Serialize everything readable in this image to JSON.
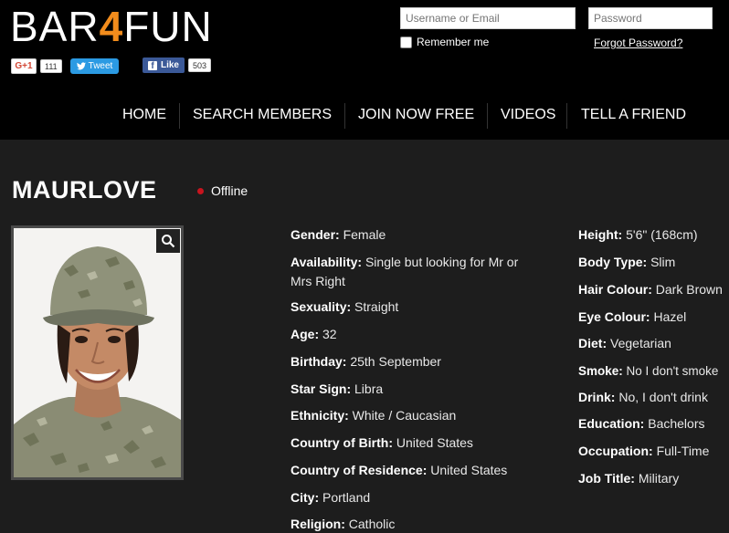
{
  "logo": {
    "part1": "BAR",
    "part2": "4",
    "part3": "FUN"
  },
  "social": {
    "gplus_label": "G+1",
    "gplus_count": "111",
    "tweet_label": "Tweet",
    "like_label": "Like",
    "like_count": "503"
  },
  "login": {
    "username_placeholder": "Username or Email",
    "password_placeholder": "Password",
    "remember_label": "Remember me",
    "forgot_label": "Forgot Password?"
  },
  "nav": {
    "items": [
      "HOME",
      "SEARCH MEMBERS",
      "JOIN NOW FREE",
      "VIDEOS",
      "TELL A FRIEND"
    ]
  },
  "profile": {
    "name": "MAURLOVE",
    "status": "Offline",
    "status_color": "#c8141e",
    "left_fields": [
      {
        "label": "Gender:",
        "value": "Female"
      },
      {
        "label": "Availability:",
        "value": "Single but looking for Mr or Mrs Right"
      },
      {
        "label": "Sexuality:",
        "value": "Straight"
      },
      {
        "label": "Age:",
        "value": "32"
      },
      {
        "label": "Birthday:",
        "value": "25th September"
      },
      {
        "label": "Star Sign:",
        "value": "Libra"
      },
      {
        "label": "Ethnicity:",
        "value": "White / Caucasian"
      },
      {
        "label": "Country of Birth:",
        "value": "United States"
      },
      {
        "label": "Country of Residence:",
        "value": "United States"
      },
      {
        "label": "City:",
        "value": "Portland"
      },
      {
        "label": "Religion:",
        "value": "Catholic"
      }
    ],
    "right_fields": [
      {
        "label": "Height:",
        "value": "5'6\" (168cm)"
      },
      {
        "label": "Body Type:",
        "value": "Slim"
      },
      {
        "label": "Hair Colour:",
        "value": "Dark Brown"
      },
      {
        "label": "Eye Colour:",
        "value": "Hazel"
      },
      {
        "label": "Diet:",
        "value": "Vegetarian"
      },
      {
        "label": "Smoke:",
        "value": "No I don't smoke"
      },
      {
        "label": "Drink:",
        "value": "No, I don't drink"
      },
      {
        "label": "Education:",
        "value": "Bachelors"
      },
      {
        "label": "Occupation:",
        "value": "Full-Time"
      },
      {
        "label": "Job Title:",
        "value": "Military"
      }
    ]
  },
  "colors": {
    "accent": "#f28c1c",
    "header_bg": "#000000",
    "page_bg": "#1d1d1d"
  }
}
